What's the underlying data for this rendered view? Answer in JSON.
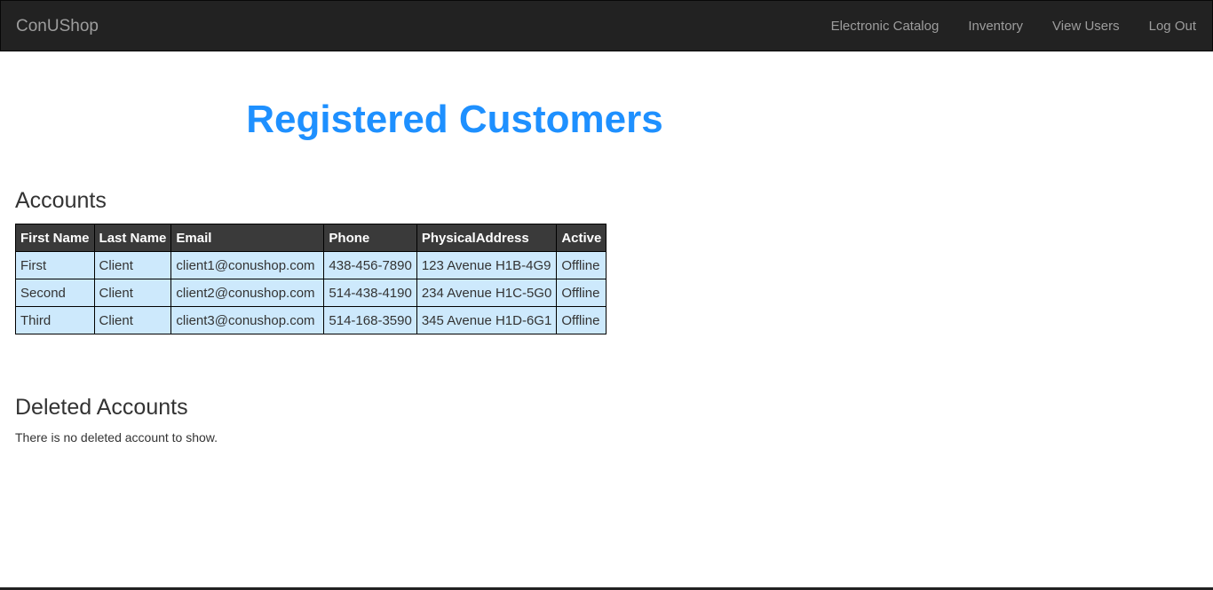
{
  "navbar": {
    "brand": "ConUShop",
    "links": [
      {
        "label": "Electronic Catalog"
      },
      {
        "label": "Inventory"
      },
      {
        "label": "View Users"
      },
      {
        "label": "Log Out"
      }
    ]
  },
  "main": {
    "title": "Registered Customers",
    "accounts": {
      "heading": "Accounts",
      "columns": [
        "First Name",
        "Last Name",
        "Email",
        "Phone",
        "PhysicalAddress",
        "Active"
      ],
      "rows": [
        [
          "First",
          "Client",
          "client1@conushop.com",
          "438-456-7890",
          "123 Avenue H1B-4G9",
          "Offline"
        ],
        [
          "Second",
          "Client",
          "client2@conushop.com",
          "514-438-4190",
          "234 Avenue H1C-5G0",
          "Offline"
        ],
        [
          "Third",
          "Client",
          "client3@conushop.com",
          "514-168-3590",
          "345 Avenue H1D-6G1",
          "Offline"
        ]
      ]
    },
    "deleted": {
      "heading": "Deleted Accounts",
      "empty_message": "There is no deleted account to show."
    }
  },
  "colors": {
    "navbar_bg": "#222222",
    "nav_text": "#9d9d9d",
    "title": "#1e90ff",
    "table_header_bg": "#3a3a3a",
    "table_row_bg": "#cde9fc"
  }
}
